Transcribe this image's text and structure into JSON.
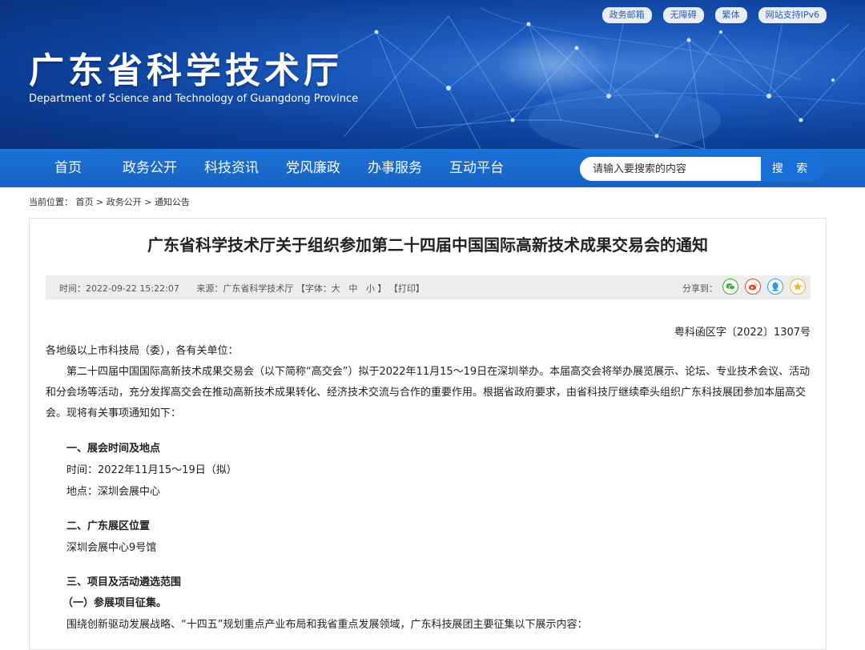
{
  "top_links": [
    "政务邮箱",
    "无障碍",
    "繁体",
    "网站支持IPv6"
  ],
  "site": {
    "title": "广东省科学技术厅",
    "subtitle": "Department of Science and Technology of Guangdong Province"
  },
  "nav": {
    "items": [
      "首页",
      "政务公开",
      "科技资讯",
      "党风廉政",
      "办事服务",
      "互动平台"
    ]
  },
  "search": {
    "placeholder": "请输入要搜索的内容",
    "button": "搜 索"
  },
  "breadcrumb": {
    "prefix": "当前位置：",
    "items": [
      "首页",
      "政务公开",
      "通知公告"
    ],
    "separator": ">"
  },
  "article": {
    "title": "广东省科学技术厅关于组织参加第二十四届中国国际高新技术成果交易会的通知",
    "meta": {
      "time": "时间：2022-09-22 15:22:07",
      "source": "来源：广东省科学技术厅",
      "font_prefix": "【字体：",
      "font_big": "大",
      "font_mid": "中",
      "font_small": "小",
      "font_suffix": "】",
      "print": "【打印】",
      "share_label": "分享到："
    },
    "doc_number": "粤科函区字〔2022〕1307号",
    "salutation": "各地级以上市科技局（委），各有关单位：",
    "intro": "第二十四届中国国际高新技术成果交易会（以下简称“高交会”）拟于2022年11月15～19日在深圳举办。本届高交会将举办展览展示、论坛、专业技术会议、活动和分会场等活动，充分发挥高交会在推动高新技术成果转化、经济技术交流与合作的重要作用。根据省政府要求，由省科技厅继续牵头组织广东科技展团参加本届高交会。现将有关事项通知如下：",
    "section1_title": "一、展会时间及地点",
    "section1_time": "时间：2022年11月15～19日（拟）",
    "section1_place": "地点：深圳会展中心",
    "section2_title": "二、广东展区位置",
    "section2_text": "深圳会展中心9号馆",
    "section3_title": "三、项目及活动遴选范围",
    "section3_sub": "（一）参展项目征集。",
    "section3_text": "围绕创新驱动发展战略、“十四五”规划重点产业布局和我省重点发展领域，广东科技展团主要征集以下展示内容："
  },
  "colors": {
    "nav_bg": "#1768c9",
    "search_btn": "#1670d8",
    "wechat": "#3cb034",
    "weibo": "#e0462e",
    "qq": "#2d9be4",
    "qzone": "#f0b32a"
  },
  "icons": {
    "share": [
      "wechat-icon",
      "weibo-icon",
      "qq-icon",
      "qzone-icon"
    ]
  }
}
